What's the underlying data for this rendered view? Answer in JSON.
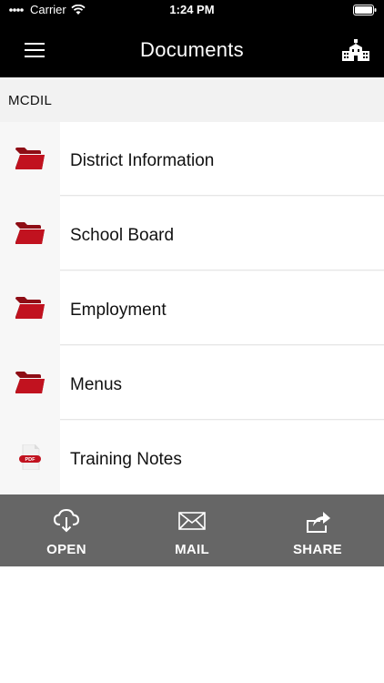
{
  "status_bar": {
    "carrier": "Carrier",
    "time": "1:24 PM"
  },
  "nav": {
    "title": "Documents"
  },
  "section": {
    "label": "MCDIL"
  },
  "items": [
    {
      "label": "District Information",
      "icon": "folder-icon"
    },
    {
      "label": "School Board",
      "icon": "folder-icon"
    },
    {
      "label": "Employment",
      "icon": "folder-icon"
    },
    {
      "label": "Menus",
      "icon": "folder-icon"
    },
    {
      "label": "Training Notes",
      "icon": "pdf-icon",
      "badge": "PDF"
    }
  ],
  "toolbar": {
    "open_label": "OPEN",
    "mail_label": "MAIL",
    "share_label": "SHARE"
  },
  "colors": {
    "accent": "#c1121f",
    "navbar": "#000000",
    "toolbar": "#666666"
  }
}
